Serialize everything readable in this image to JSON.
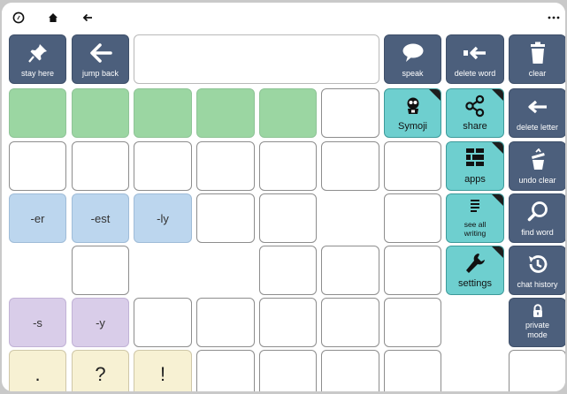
{
  "topbar": {
    "left_icons": [
      "compass-icon",
      "home-icon",
      "back-arrow-icon"
    ],
    "right_icon": "more-dots-icon"
  },
  "toolbar": {
    "stay_here": "stay here",
    "jump_back": "jump back",
    "message_text": "",
    "speak": "speak",
    "delete_word": "delete word",
    "clear": "clear"
  },
  "teal_buttons": {
    "symoji": "Symoji",
    "share": "share",
    "apps": "apps",
    "see_all_writing": "see all writing",
    "settings": "settings"
  },
  "side_buttons": {
    "delete_letter": "delete letter",
    "undo_clear": "undo clear",
    "find_word": "find word",
    "chat_history": "chat history",
    "private_mode": "private mode"
  },
  "word_endings": {
    "er": "-er",
    "est": "-est",
    "ly": "-ly",
    "s": "-s",
    "y": "-y"
  },
  "punctuation": {
    "period": ".",
    "question": "?",
    "exclamation": "!"
  },
  "colors": {
    "toolbar_dark": "#4c5f7c",
    "teal": "#6ecfcf",
    "green": "#9bd6a2",
    "blue": "#bcd6ee",
    "purple": "#d9cde9",
    "cream": "#f7f1d3"
  }
}
